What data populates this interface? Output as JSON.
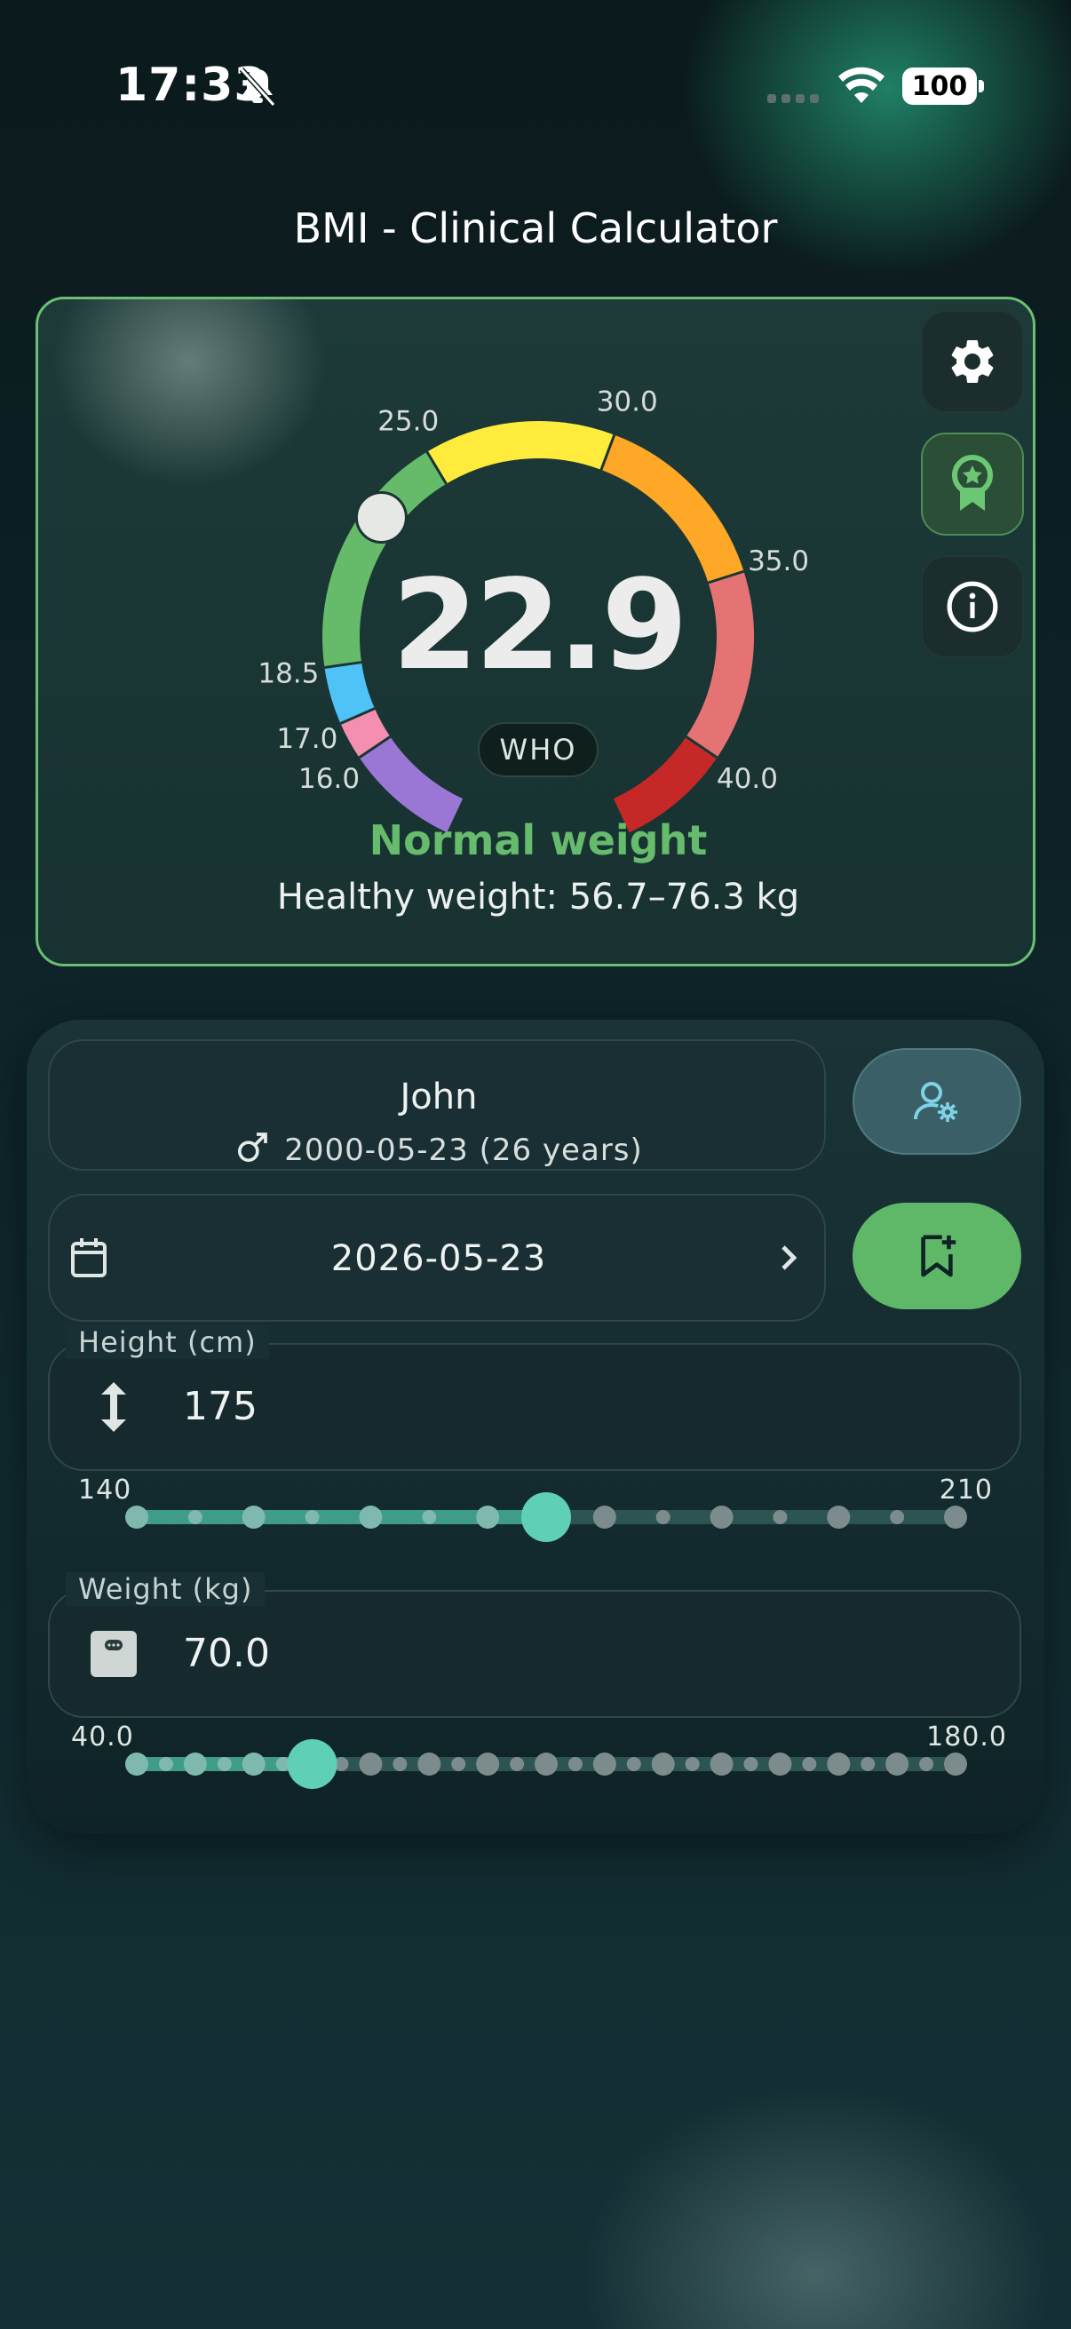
{
  "status_bar": {
    "time": "17:33",
    "battery": "100"
  },
  "app": {
    "title": "BMI - Clinical Calculator"
  },
  "gauge": {
    "value": "22.9",
    "standard": "WHO",
    "category": "Normal weight",
    "healthy_range": "Healthy weight: 56.7–76.3 kg",
    "tick_labels": [
      "16.0",
      "17.0",
      "18.5",
      "25.0",
      "30.0",
      "35.0",
      "40.0"
    ],
    "min": 13,
    "max": 43,
    "current": 22.9,
    "segments": [
      {
        "from": 13,
        "to": 16,
        "color": "#9a77d4"
      },
      {
        "from": 16,
        "to": 17,
        "color": "#f48fb1"
      },
      {
        "from": 17,
        "to": 18.5,
        "color": "#4fc3f7"
      },
      {
        "from": 18.5,
        "to": 25,
        "color": "#66bb6a"
      },
      {
        "from": 25,
        "to": 30,
        "color": "#ffeb3b"
      },
      {
        "from": 30,
        "to": 35,
        "color": "#ffa726"
      },
      {
        "from": 35,
        "to": 40,
        "color": "#e57373"
      },
      {
        "from": 40,
        "to": 43,
        "color": "#c62828"
      }
    ],
    "buttons": [
      "gear-icon",
      "award-icon",
      "info-icon"
    ]
  },
  "profile": {
    "name": "John",
    "details": "2000-05-23 (26 years)",
    "sex_icon": "male-icon"
  },
  "date": {
    "value": "2026-05-23"
  },
  "height": {
    "label": "Height (cm)",
    "value": "175",
    "min_label": "140",
    "max_label": "210",
    "min": 140,
    "max": 210,
    "current": 175,
    "step_dots": 15
  },
  "weight": {
    "label": "Weight (kg)",
    "value": "70.0",
    "min_label": "40.0",
    "max_label": "180.0",
    "min": 40,
    "max": 180,
    "current": 70,
    "step_dots": 29
  },
  "colors": {
    "accent": "#5fd0b4",
    "normal": "#67bb6d",
    "card_border": "#6bbf73"
  }
}
